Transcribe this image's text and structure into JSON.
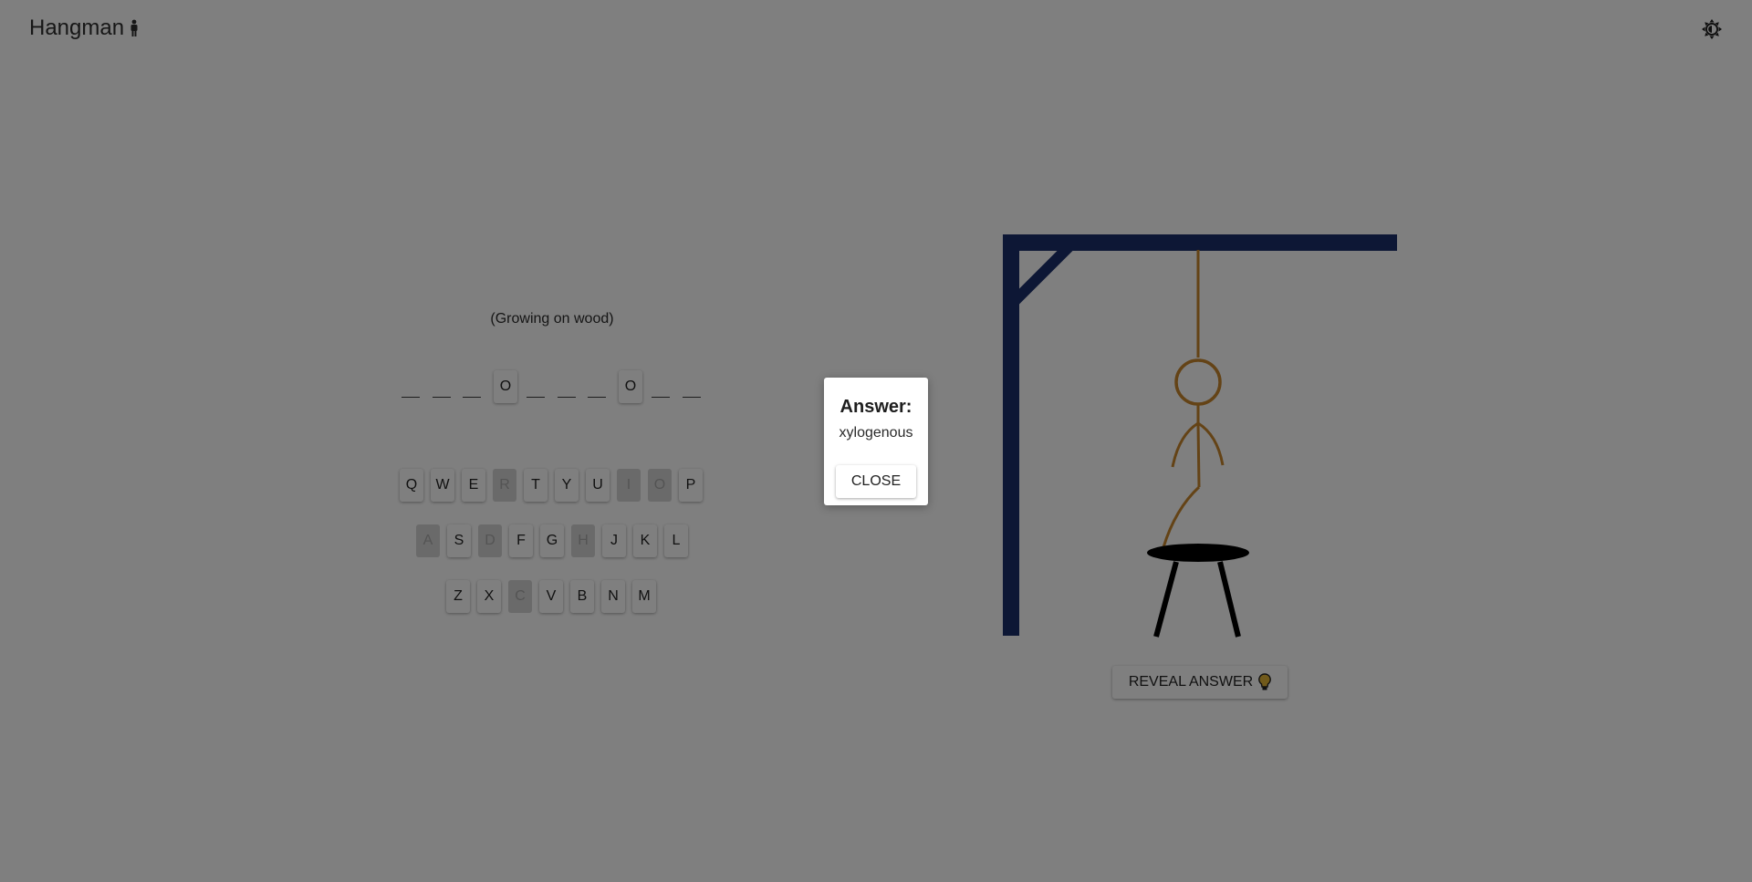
{
  "app": {
    "title": "Hangman"
  },
  "hint": "(Growing on wood)",
  "word_slots": [
    "",
    "",
    "",
    "O",
    "",
    "",
    "",
    "O",
    "",
    ""
  ],
  "keyboard": [
    {
      "letter": "Q",
      "used": false
    },
    {
      "letter": "W",
      "used": false
    },
    {
      "letter": "E",
      "used": false
    },
    {
      "letter": "R",
      "used": true
    },
    {
      "letter": "T",
      "used": false
    },
    {
      "letter": "Y",
      "used": false
    },
    {
      "letter": "U",
      "used": false
    },
    {
      "letter": "I",
      "used": true
    },
    {
      "letter": "O",
      "used": true
    },
    {
      "letter": "P",
      "used": false
    },
    {
      "letter": "A",
      "used": true
    },
    {
      "letter": "S",
      "used": false
    },
    {
      "letter": "D",
      "used": true
    },
    {
      "letter": "F",
      "used": false
    },
    {
      "letter": "G",
      "used": false
    },
    {
      "letter": "H",
      "used": true
    },
    {
      "letter": "J",
      "used": false
    },
    {
      "letter": "K",
      "used": false
    },
    {
      "letter": "L",
      "used": false
    },
    {
      "letter": "Z",
      "used": false
    },
    {
      "letter": "X",
      "used": false
    },
    {
      "letter": "C",
      "used": true
    },
    {
      "letter": "V",
      "used": false
    },
    {
      "letter": "B",
      "used": false
    },
    {
      "letter": "N",
      "used": false
    },
    {
      "letter": "M",
      "used": false
    }
  ],
  "reveal_button": {
    "label": "REVEAL ANSWER"
  },
  "modal": {
    "title": "Answer:",
    "answer": "xylogenous",
    "close_label": "CLOSE"
  },
  "colors": {
    "gallows": "#1a2f6b",
    "rope": "#c8862c",
    "figure": "#c8862c",
    "stool": "#000000",
    "overlay": "rgba(0,0,0,0.5)"
  },
  "icons": {
    "title_icon": "person-icon",
    "theme_icon": "brightness-icon",
    "reveal_icon": "lightbulb-icon"
  }
}
